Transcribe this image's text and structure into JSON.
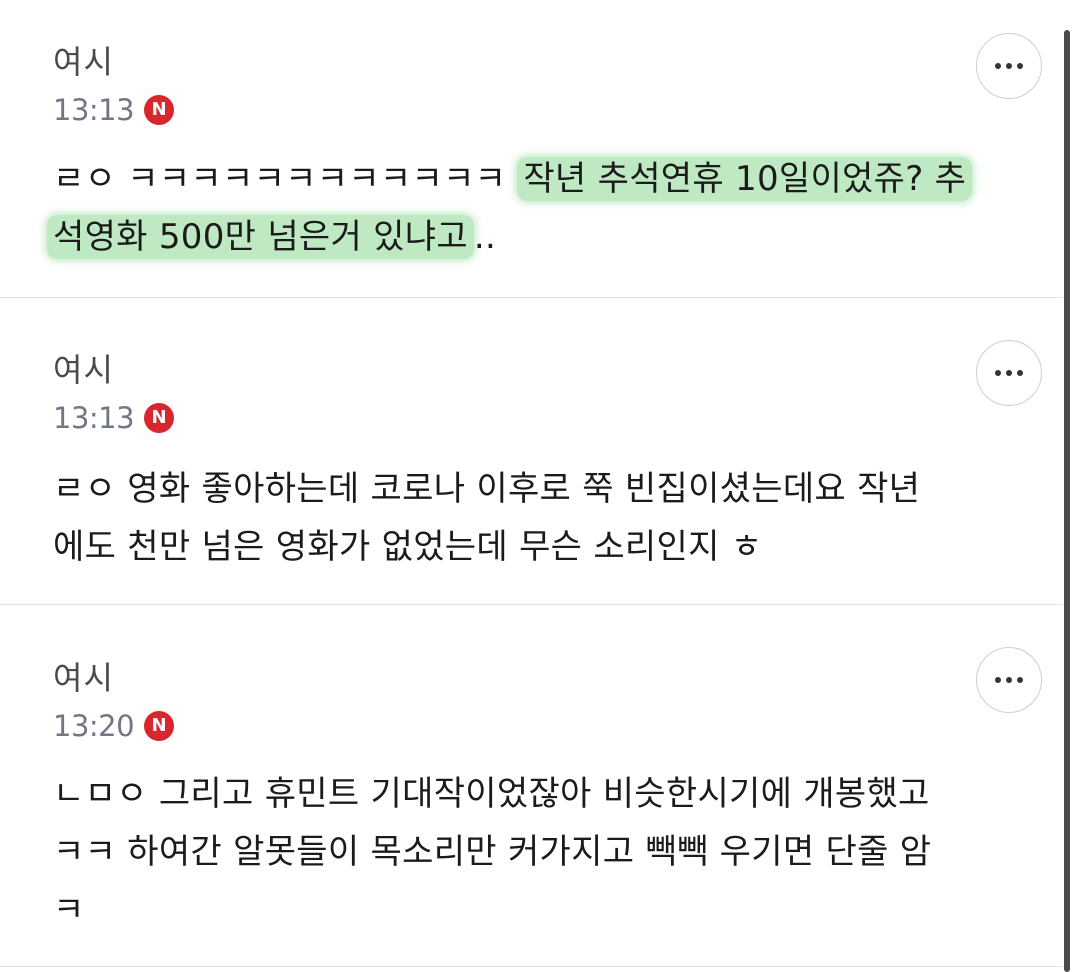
{
  "comments": [
    {
      "author": "여시",
      "time": "13:13",
      "badge": "N",
      "body_plain": "ㄹㅇ ㅋㅋㅋㅋㅋㅋㅋㅋㅋㅋㅋㅋ ",
      "body_highlight_1": "작년 추석연휴 10일이었쥬? 추",
      "body_highlight_2": "석영화 500만 넘은거 있냐고",
      "body_tail": ".."
    },
    {
      "author": "여시",
      "time": "13:13",
      "badge": "N",
      "body_line_1": "ㄹㅇ 영화 좋아하는데 코로나 이후로 쭉 빈집이셨는데요 작년",
      "body_line_2": "에도 천만 넘은 영화가 없었는데 무슨 소리인지 ㅎ"
    },
    {
      "author": "여시",
      "time": "13:20",
      "badge": "N",
      "body_line_1": "ㄴㅁㅇ 그리고 휴민트 기대작이었잖아 비슷한시기에 개봉했고",
      "body_line_2": "ㅋㅋ 하여간 알못들이 목소리만 커가지고 빽빽 우기면 단줄 암",
      "body_line_3": "ㅋ"
    }
  ],
  "colors": {
    "badge": "#d8262e",
    "highlight": "#bfe9c2",
    "timestamp": "#727785",
    "divider": "#e3e3e6"
  },
  "icons": {
    "more": "more-horizontal-icon"
  }
}
